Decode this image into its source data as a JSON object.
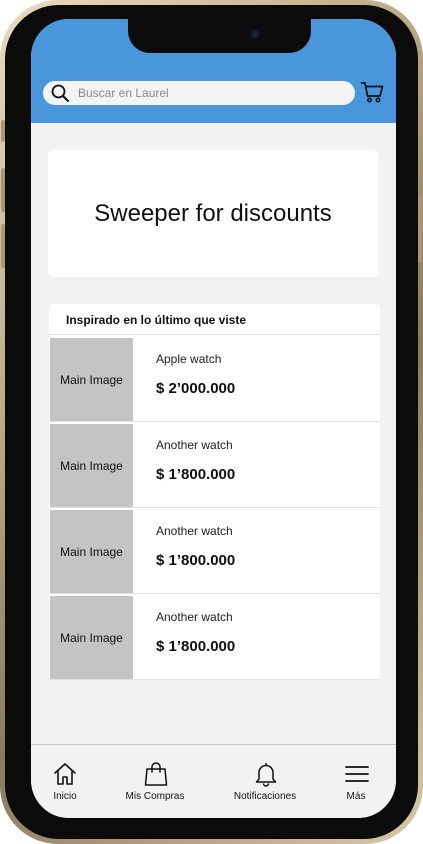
{
  "search": {
    "placeholder": "Buscar en Laurel"
  },
  "promo": {
    "title": "Sweeper for discounts"
  },
  "recommendations": {
    "title": "Inspirado en lo último que viste",
    "items": [
      {
        "image_label": "Main Image",
        "name": "Apple watch",
        "price": "$ 2’000.000"
      },
      {
        "image_label": "Main Image",
        "name": "Another watch",
        "price": "$ 1’800.000"
      },
      {
        "image_label": "Main Image",
        "name": "Another watch",
        "price": "$ 1’800.000"
      },
      {
        "image_label": "Main Image",
        "name": "Another watch",
        "price": "$ 1’800.000"
      }
    ]
  },
  "nav": {
    "items": [
      {
        "label": "Inicio",
        "icon": "home-icon"
      },
      {
        "label": "Mis Compras",
        "icon": "shopping-bag-icon"
      },
      {
        "label": "Notificaciones",
        "icon": "bell-icon"
      },
      {
        "label": "Más",
        "icon": "menu-icon"
      }
    ]
  },
  "colors": {
    "header": "#4a96dc",
    "background": "#f2f2f2",
    "image_placeholder": "#c4c4c4"
  }
}
